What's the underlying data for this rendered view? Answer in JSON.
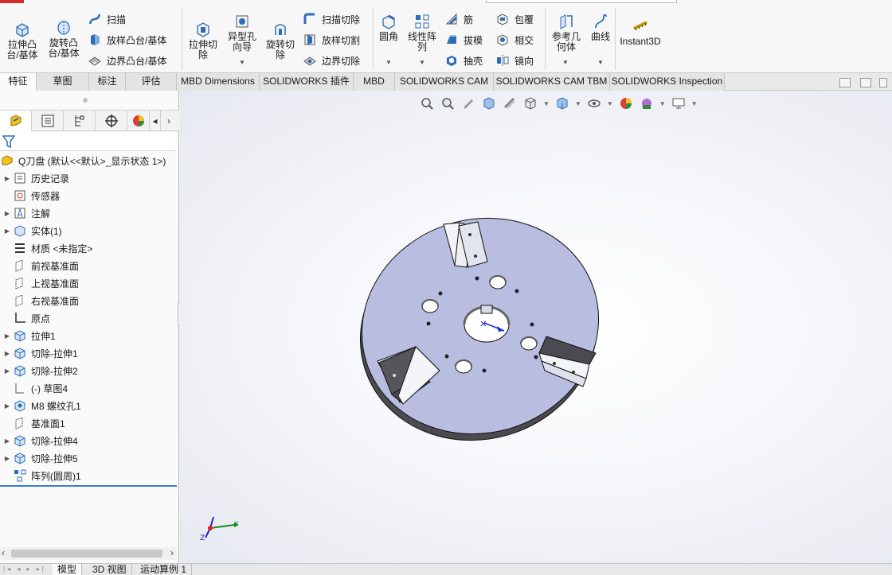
{
  "ribbon": {
    "extrude_boss": "拉伸凸\n台/基体",
    "revolve_boss": "旋转凸\n台/基体",
    "sweep": "扫描",
    "loft_boss": "放样凸台/基体",
    "boundary_boss": "边界凸台/基体",
    "extrude_cut": "拉伸切\n除",
    "hole_wizard": "异型孔\n向导",
    "revolve_cut": "旋转切\n除",
    "swept_cut": "扫描切除",
    "lofted_cut": "放样切割",
    "boundary_cut": "边界切除",
    "fillet": "圆角",
    "linear_pattern": "线性阵\n列",
    "rib": "筋",
    "draft": "拔模",
    "shell": "抽壳",
    "wrap": "包覆",
    "intersect": "相交",
    "mirror": "镜向",
    "ref_geometry": "参考几\n何体",
    "curves": "曲线",
    "instant3d": "Instant3D"
  },
  "tabs": [
    "特征",
    "草图",
    "标注",
    "评估",
    "MBD Dimensions",
    "SOLIDWORKS 插件",
    "MBD",
    "SOLIDWORKS CAM",
    "SOLIDWORKS CAM TBM",
    "SOLIDWORKS Inspection"
  ],
  "tree": {
    "root": "Q刀盘  (默认<<默认>_显示状态 1>)",
    "items": [
      {
        "label": "历史记录",
        "exp": true
      },
      {
        "label": "传感器",
        "exp": false
      },
      {
        "label": "注解",
        "exp": true
      },
      {
        "label": "实体(1)",
        "exp": true
      },
      {
        "label": "材质 <未指定>",
        "exp": false
      },
      {
        "label": "前视基准面",
        "exp": false
      },
      {
        "label": "上视基准面",
        "exp": false
      },
      {
        "label": "右视基准面",
        "exp": false
      },
      {
        "label": "原点",
        "exp": false
      },
      {
        "label": "拉伸1",
        "exp": true
      },
      {
        "label": "切除-拉伸1",
        "exp": true
      },
      {
        "label": "切除-拉伸2",
        "exp": true
      },
      {
        "label": "(-) 草图4",
        "exp": false
      },
      {
        "label": "M8 螺纹孔1",
        "exp": true
      },
      {
        "label": "基准面1",
        "exp": false
      },
      {
        "label": "切除-拉伸4",
        "exp": true
      },
      {
        "label": "切除-拉伸5",
        "exp": true
      },
      {
        "label": "阵列(圆周)1",
        "exp": false
      }
    ]
  },
  "triad": {
    "y": "Y",
    "z": "Z"
  },
  "bottom_tabs": [
    "模型",
    "3D 视图",
    "运动算例 1"
  ]
}
